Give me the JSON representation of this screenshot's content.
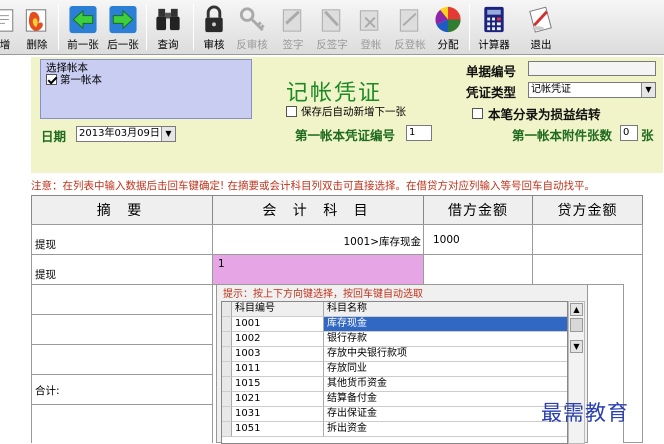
{
  "toolbar": {
    "buttons": [
      {
        "label": "增",
        "icon": "add-icon"
      },
      {
        "label": "删除",
        "icon": "delete-icon"
      },
      {
        "label": "前一张",
        "icon": "left-arrow-icon"
      },
      {
        "label": "后一张",
        "icon": "right-arrow-icon"
      },
      {
        "label": "查询",
        "icon": "binoculars-icon"
      },
      {
        "label": "审核",
        "icon": "lock-icon"
      },
      {
        "label": "反审核",
        "icon": "unlock-icon"
      },
      {
        "label": "签字",
        "icon": "sign-icon"
      },
      {
        "label": "反签字",
        "icon": "unsign-icon"
      },
      {
        "label": "登帐",
        "icon": "post-icon"
      },
      {
        "label": "反登帐",
        "icon": "unpost-icon"
      },
      {
        "label": "分配",
        "icon": "pie-chart-icon"
      },
      {
        "label": "计算器",
        "icon": "calculator-icon"
      },
      {
        "label": "退出",
        "icon": "exit-icon"
      }
    ]
  },
  "header": {
    "account_set_legend": "选择帐本",
    "account_set_item": "第一帐本",
    "title": "记帐凭证",
    "auto_new_label": "保存后自动新增下一张",
    "doc_no_label": "单据编号",
    "voucher_type_label": "凭证类型",
    "voucher_type_value": "记帐凭证",
    "profit_transfer_label": "本笔分录为损益结转",
    "date_label": "日期",
    "date_value": "2013年03月09日",
    "voucher_no_label": "第一帐本凭证编号",
    "voucher_no_value": "1",
    "attach_label": "第一帐本附件张数",
    "attach_value": "0",
    "attach_unit": "张"
  },
  "notice": "注意：在列表中输入数据后击回车键确定! 在摘要或会计科目列双击可直接选择。在借贷方对应列输入等号回车自动找平。",
  "table": {
    "headers": [
      "摘  要",
      "会 计 科 目",
      "借方金额",
      "贷方金额"
    ],
    "rows": [
      {
        "summary": "提现",
        "account": "1001>库存现金",
        "debit": "1000",
        "credit": ""
      },
      {
        "summary": "提现",
        "account": "1",
        "debit": "",
        "credit": ""
      }
    ],
    "total_label": "合计:"
  },
  "popup": {
    "hint": "提示：按上下方向键选择，按回车键自动选取",
    "col_code": "科目编号",
    "col_name": "科目名称",
    "rows": [
      {
        "code": "1001",
        "name": "库存现金"
      },
      {
        "code": "1002",
        "name": "银行存款"
      },
      {
        "code": "1003",
        "name": "存放中央银行款项"
      },
      {
        "code": "1011",
        "name": "存放同业"
      },
      {
        "code": "1015",
        "name": "其他货币资金"
      },
      {
        "code": "1021",
        "name": "结算备付金"
      },
      {
        "code": "1031",
        "name": "存出保证金"
      },
      {
        "code": "1051",
        "name": "拆出资金"
      }
    ]
  },
  "watermark": "最需教育",
  "colors": {
    "accent_green": "#1d8a26",
    "notice_red": "#c0321b",
    "selection_blue": "#3168c4",
    "panel_yellow": "#f1f3c9",
    "panel_lavender": "#c9cdf2",
    "input_pink": "#e6a6e6"
  }
}
